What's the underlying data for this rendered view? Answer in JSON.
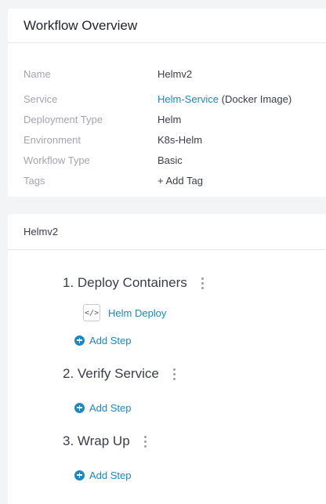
{
  "overview": {
    "title": "Workflow Overview",
    "fields": {
      "name": {
        "label": "Name",
        "value": "Helmv2"
      },
      "service": {
        "label": "Service",
        "link": "Helm-Service",
        "suffix": " (Docker Image)"
      },
      "deployment_type": {
        "label": "Deployment Type",
        "value": "Helm"
      },
      "environment": {
        "label": "Environment",
        "link": "K8s-Helm"
      },
      "workflow_type": {
        "label": "Workflow Type",
        "value": "Basic"
      },
      "tags": {
        "label": "Tags",
        "link": "+ Add Tag"
      }
    }
  },
  "workflow": {
    "title": "Helmv2",
    "phases": [
      {
        "title": "1. Deploy Containers",
        "steps": [
          {
            "icon": "code-icon",
            "label": "Helm Deploy"
          }
        ],
        "add_label": "Add Step"
      },
      {
        "title": "2. Verify Service",
        "steps": [],
        "add_label": "Add Step"
      },
      {
        "title": "3. Wrap Up",
        "steps": [],
        "add_label": "Add Step"
      }
    ]
  },
  "colors": {
    "link": "#1a89bf",
    "label": "#a3a5ad",
    "background": "#f3f4f6"
  }
}
